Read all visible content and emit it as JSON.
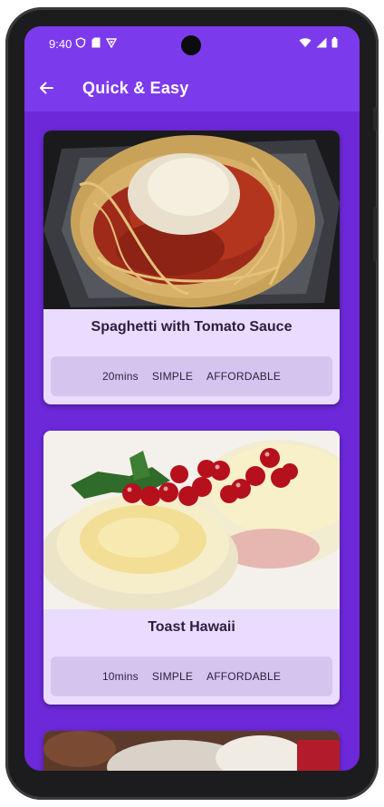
{
  "status_bar": {
    "time": "9:40"
  },
  "app_bar": {
    "title": "Quick & Easy"
  },
  "meals": [
    {
      "title": "Spaghetti with Tomato Sauce",
      "duration": "20mins",
      "complexity": "SIMPLE",
      "affordability": "AFFORDABLE"
    },
    {
      "title": "Toast Hawaii",
      "duration": "10mins",
      "complexity": "SIMPLE",
      "affordability": "AFFORDABLE"
    }
  ],
  "colors": {
    "primary": "#7c3aed",
    "background": "#6d28d9",
    "card": "#e9dcff",
    "meta_bar": "#d4c5ee"
  }
}
